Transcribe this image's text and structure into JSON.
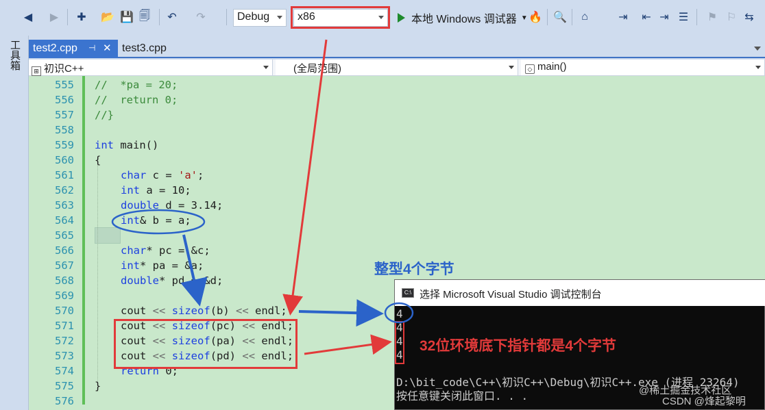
{
  "toolbar": {
    "config": "Debug",
    "platform": "x86",
    "debugger_label": "本地 Windows 调试器"
  },
  "side_panel": {
    "label": "工具箱"
  },
  "tabs": [
    {
      "label": "test2.cpp",
      "active": true
    },
    {
      "label": "test3.cpp",
      "active": false
    }
  ],
  "navbar": {
    "project": "初识C++",
    "scope": "(全局范围)",
    "member": "main()"
  },
  "code_lines": [
    {
      "num": "555",
      "text": "//  *pa = 20;"
    },
    {
      "num": "556",
      "text": "//  return 0;"
    },
    {
      "num": "557",
      "text": "//}"
    },
    {
      "num": "558",
      "text": ""
    },
    {
      "num": "559",
      "text": "int main()"
    },
    {
      "num": "560",
      "text": "{"
    },
    {
      "num": "561",
      "text": "char c = 'a';"
    },
    {
      "num": "562",
      "text": "int a = 10;"
    },
    {
      "num": "563",
      "text": "double d = 3.14;"
    },
    {
      "num": "564",
      "text": "int& b = a;"
    },
    {
      "num": "565",
      "text": ""
    },
    {
      "num": "566",
      "text": "char* pc = &c;"
    },
    {
      "num": "567",
      "text": "int* pa = &a;"
    },
    {
      "num": "568",
      "text": "double* pd = &d;"
    },
    {
      "num": "569",
      "text": ""
    },
    {
      "num": "570",
      "text": "cout << sizeof(b) << endl;"
    },
    {
      "num": "571",
      "text": "cout << sizeof(pc) << endl;"
    },
    {
      "num": "572",
      "text": "cout << sizeof(pa) << endl;"
    },
    {
      "num": "573",
      "text": "cout << sizeof(pd) << endl;"
    },
    {
      "num": "574",
      "text": "return 0;"
    },
    {
      "num": "575",
      "text": "}"
    },
    {
      "num": "576",
      "text": ""
    }
  ],
  "annotations": {
    "int_size": "整型4个字节",
    "pointer_size": "32位环境底下指针都是4个字节"
  },
  "console": {
    "title": "选择 Microsoft Visual Studio 调试控制台",
    "output": [
      "4",
      "4",
      "4",
      "4"
    ],
    "path_line": "D:\\bit_code\\C++\\初识C++\\Debug\\初识C++.exe (进程 23264)",
    "press_key": "按任意键关闭此窗口. . ."
  },
  "watermark": {
    "left": "@稀土掘金技术社区",
    "right": "CSDN @烽起黎明"
  },
  "colors": {
    "accent_red": "#e23a3a",
    "accent_blue": "#2b63c9",
    "editor_bg": "#c9e8cb"
  }
}
